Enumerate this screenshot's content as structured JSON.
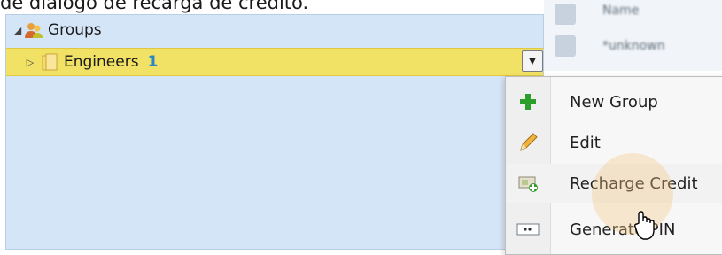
{
  "caption": "de diálogo de recarga de crédito.",
  "tree": {
    "groups_expander": "◢",
    "groups_label": "Groups",
    "engineers_expander": "▷",
    "engineers_label": "Engineers",
    "engineers_count": "1",
    "dropdown_glyph": "▼"
  },
  "background": {
    "row1": "Name",
    "row2": "*unknown"
  },
  "context_menu": {
    "items": [
      {
        "label": "New Group",
        "icon": "plus-icon"
      },
      {
        "label": "Edit",
        "icon": "pencil-icon"
      },
      {
        "label": "Recharge Credit",
        "icon": "recharge-icon"
      },
      {
        "label": "Generate PIN",
        "icon": "pin-icon"
      }
    ]
  },
  "colors": {
    "tree_bg": "#d4e5f7",
    "selection": "#f1e265",
    "count_text": "#2a86c8",
    "menu_bg": "#f7f7f7",
    "plus_green": "#2e9e2a"
  }
}
